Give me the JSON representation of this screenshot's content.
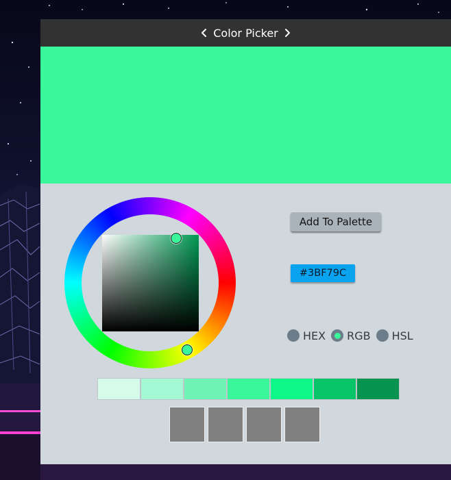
{
  "window": {
    "title": "Color Picker",
    "prev_icon": "chevron-left-icon",
    "next_icon": "chevron-right-icon"
  },
  "current_color": {
    "hex": "#3BF79C",
    "preview_color": "#3bf79c"
  },
  "actions": {
    "add_to_palette_label": "Add To Palette"
  },
  "color_modes": [
    {
      "label": "HEX",
      "selected": false
    },
    {
      "label": "RGB",
      "selected": true
    },
    {
      "label": "HSL",
      "selected": false
    }
  ],
  "shades": [
    "#d4fce9",
    "#a3f9d3",
    "#6ef5b6",
    "#3bf79c",
    "#0df888",
    "#07c469",
    "#06934f"
  ],
  "palette_slots": [
    "#808080",
    "#808080",
    "#808080",
    "#808080"
  ],
  "colors": {
    "titlebar": "#323232",
    "panel": "#d1d8dd",
    "hex_badge": "#0aa3f0",
    "radio": "#6b7d8a"
  }
}
